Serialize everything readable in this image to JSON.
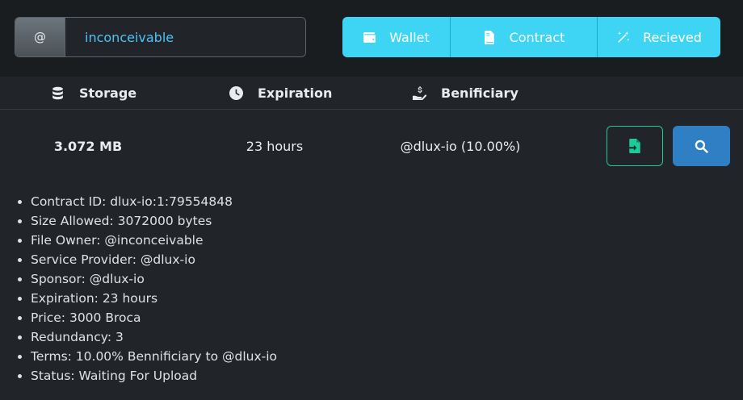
{
  "search": {
    "prefix": "@",
    "value": "inconceivable"
  },
  "nav": {
    "wallet_label": "Wallet",
    "contract_label": "Contract",
    "recieved_label": "Recieved"
  },
  "table": {
    "headers": {
      "storage": "Storage",
      "expiration": "Expiration",
      "beneficiary": "Benificiary"
    },
    "row": {
      "storage": "3.072 MB",
      "expiration": "23 hours",
      "beneficiary": "@dlux-io (10.00%)"
    }
  },
  "details": [
    "Contract ID: dlux-io:1:79554848",
    "Size Allowed: 3072000 bytes",
    "File Owner: @inconceivable",
    "Service Provider: @dlux-io",
    "Sponsor: @dlux-io",
    "Expiration: 23 hours",
    "Price: 3000 Broca",
    "Redundancy: 3",
    "Terms: 10.00% Bennificiary to @dlux-io",
    "Status: Waiting For Upload"
  ],
  "colors": {
    "accent_cyan": "#3dd5f3",
    "upload_border": "#20c997",
    "search_button": "#2f7fc4",
    "username_text": "#4fc3f7"
  },
  "icons": {
    "wallet": "wallet-icon",
    "contract": "file-contract-icon",
    "recieved": "magic-wand-icon",
    "storage": "database-icon",
    "expiration": "clock-icon",
    "beneficiary": "hand-holding-dollar-icon",
    "upload": "file-import-icon",
    "search": "search-icon"
  }
}
